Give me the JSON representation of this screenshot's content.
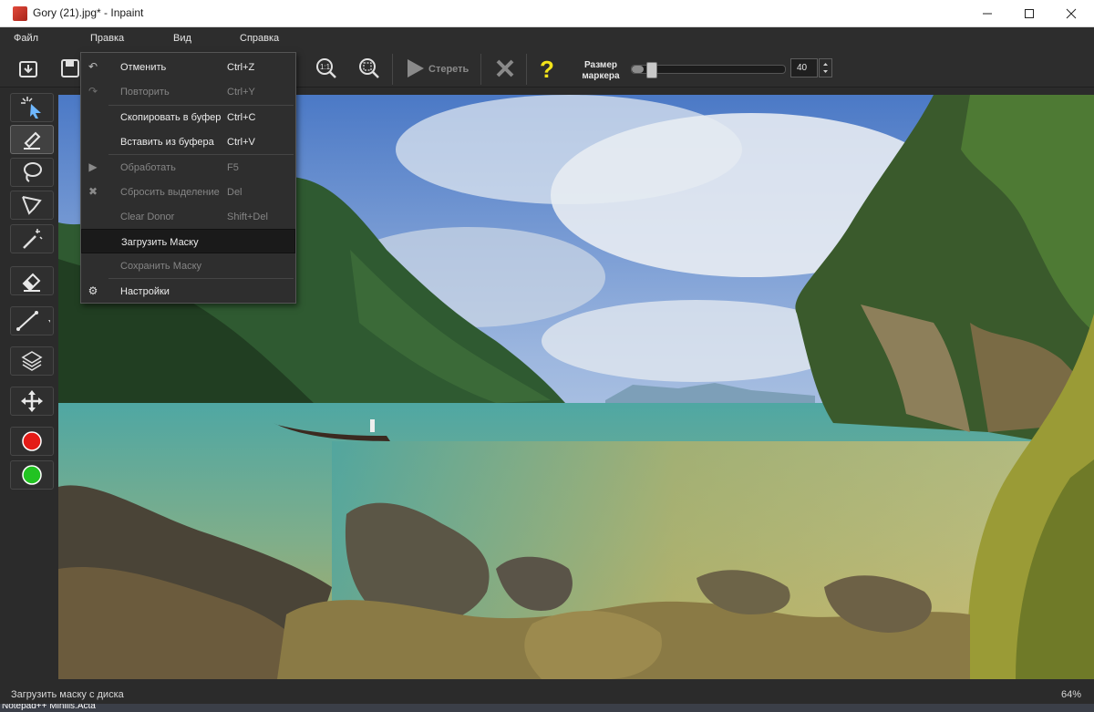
{
  "window": {
    "title": "Gory (21).jpg* - Inpaint",
    "minimize_icon": "minimize-icon",
    "maximize_icon": "maximize-icon",
    "close_icon": "close-icon"
  },
  "menubar": {
    "items": [
      "Файл",
      "Правка",
      "Вид",
      "Справка"
    ]
  },
  "toolbar": {
    "erase_label": "Стереть",
    "marker_size_label_line1": "Размер",
    "marker_size_label_line2": "маркера",
    "marker_size_value": "40",
    "marker_size_fraction": 0.08
  },
  "edit_menu": {
    "items": [
      {
        "label": "Отменить",
        "shortcut": "Ctrl+Z",
        "icon": "undo-icon",
        "enabled": true
      },
      {
        "label": "Повторить",
        "shortcut": "Ctrl+Y",
        "icon": "redo-icon",
        "enabled": false
      },
      {
        "label": "Скопировать в буфер",
        "shortcut": "Ctrl+C",
        "icon": "",
        "enabled": true
      },
      {
        "label": "Вставить из буфера",
        "shortcut": "Ctrl+V",
        "icon": "",
        "enabled": true
      },
      {
        "label": "Обработать",
        "shortcut": "F5",
        "icon": "play-icon",
        "enabled": false
      },
      {
        "label": "Сбросить выделение",
        "shortcut": "Del",
        "icon": "x-icon",
        "enabled": false
      },
      {
        "label": "Clear Donor",
        "shortcut": "Shift+Del",
        "icon": "",
        "enabled": false
      },
      {
        "label": "Загрузить Маску",
        "shortcut": "",
        "icon": "",
        "enabled": true,
        "highlighted": true
      },
      {
        "label": "Сохранить Маску",
        "shortcut": "",
        "icon": "",
        "enabled": false
      },
      {
        "label": "Настройки",
        "shortcut": "",
        "icon": "gear-icon",
        "enabled": true
      }
    ]
  },
  "status": {
    "text": "Загрузить маску с диска",
    "zoom": "64%"
  },
  "taskbar": {
    "text": "Notepad++  Minilis.Acta"
  },
  "colors": {
    "red_marker": "#e41b17",
    "green_marker": "#22c322",
    "help_yellow": "#f3e31a"
  }
}
